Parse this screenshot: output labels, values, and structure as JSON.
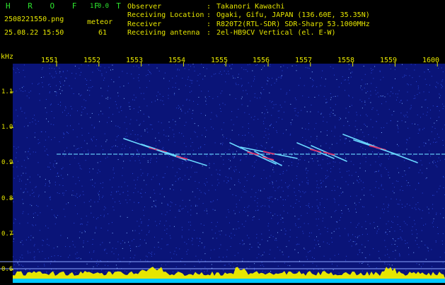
{
  "header": {
    "app_title": "H R O F F T",
    "version": "1.0.0",
    "filename": "2508221550.png",
    "timestamp": "25.08.22 15:50",
    "meteor_label": "meteor",
    "meteor_count": "61"
  },
  "station": [
    {
      "key": "Observer",
      "value": "Takanori Kawachi"
    },
    {
      "key": "Receiving Location",
      "value": "Ogaki, Gifu, JAPAN (136.60E, 35.35N)"
    },
    {
      "key": "Receiver",
      "value": "R820T2(RTL-SDR) SDR-Sharp 53.1000MHz"
    },
    {
      "key": "Receiving antenna",
      "value": "2el-HB9CV Vertical (el. E-W)"
    }
  ],
  "spectrogram": {
    "y_unit": "kHz",
    "y_ticks": [
      "1.1",
      "1.0",
      "0.9",
      "0.8",
      "0.7",
      "0.6"
    ],
    "x_ticks": [
      "1551",
      "1552",
      "1553",
      "1554",
      "1555",
      "1556",
      "1557",
      "1558",
      "1559",
      "1600"
    ],
    "carrier_khz": 0.925,
    "colors": {
      "background": "#0a1478",
      "noise": "#2a48d8",
      "trace": "#6ad8ff",
      "trace_hot": "#e0306a",
      "text": "#e6e600",
      "level": "#e6e600",
      "level_base": "#00c8ff"
    }
  }
}
